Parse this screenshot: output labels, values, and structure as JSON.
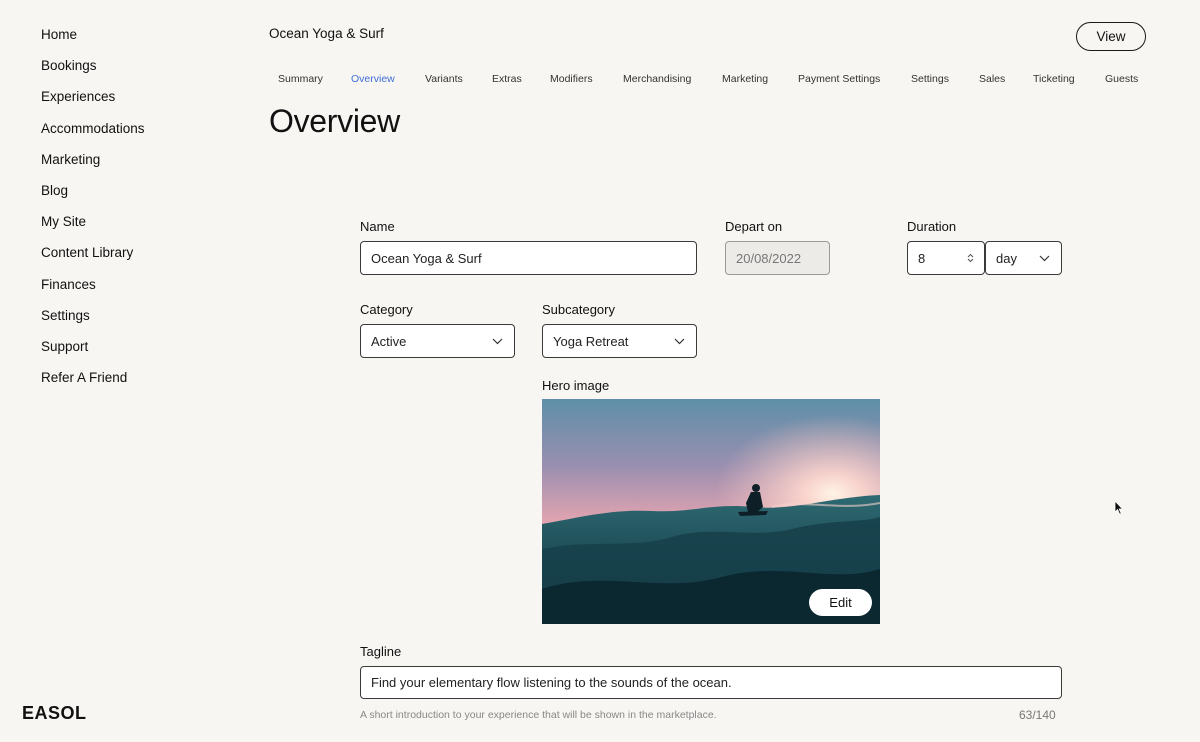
{
  "sidebar": {
    "items": [
      "Home",
      "Bookings",
      "Experiences",
      "Accommodations",
      "Marketing",
      "Blog",
      "My Site",
      "Content Library",
      "Finances",
      "Settings",
      "Support",
      "Refer A Friend"
    ],
    "logo": "EASOL"
  },
  "header": {
    "experience_title": "Ocean Yoga & Surf",
    "view_label": "View"
  },
  "tabs": {
    "items": [
      "Summary",
      "Overview",
      "Variants",
      "Extras",
      "Modifiers",
      "Merchandising",
      "Marketing",
      "Payment Settings",
      "Settings",
      "Sales",
      "Ticketing",
      "Guests"
    ],
    "active": "Overview"
  },
  "page_title": "Overview",
  "form": {
    "name": {
      "label": "Name",
      "value": "Ocean Yoga & Surf"
    },
    "depart_on": {
      "label": "Depart on",
      "value": "20/08/2022"
    },
    "duration": {
      "label": "Duration",
      "value": "8",
      "unit": "day"
    },
    "category": {
      "label": "Category",
      "value": "Active"
    },
    "subcategory": {
      "label": "Subcategory",
      "value": "Yoga Retreat"
    },
    "hero_image": {
      "label": "Hero image",
      "edit_label": "Edit"
    },
    "tagline": {
      "label": "Tagline",
      "value": "Find your elementary flow listening to the sounds of the ocean.",
      "helper": "A short introduction to your experience that will be shown in the marketplace.",
      "counter": "63/140"
    }
  },
  "colors": {
    "background": "#f8f6f2",
    "accent": "#3f6fd6",
    "text": "#111111"
  },
  "icons": {
    "dropdown": "chevron-down-icon",
    "stepper": "stepper-arrows-icon",
    "cursor": "mouse-pointer-icon"
  }
}
